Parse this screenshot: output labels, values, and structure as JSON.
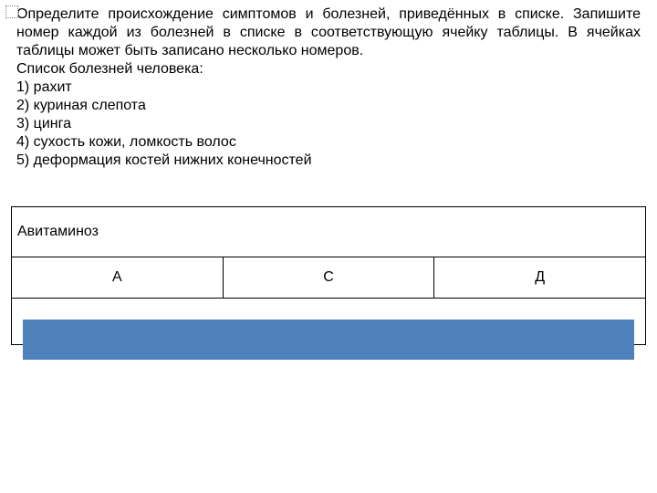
{
  "task": {
    "instruction": "Определите происхождение симптомов и болезней, приведённых в списке. Запишите номер каждой из болезней в списке в соответствующую ячейку таблицы. В ячейках таблицы может быть записано несколько номеров.",
    "list_title": "Список болезней человека:",
    "items": [
      "1) рахит",
      "2) куриная слепота",
      "3) цинга",
      "4) сухость кожи, ломкость волос",
      "5) деформация костей нижних конечностей"
    ]
  },
  "table": {
    "header": "Авитаминоз",
    "columns": [
      "А",
      "С",
      "Д"
    ]
  }
}
